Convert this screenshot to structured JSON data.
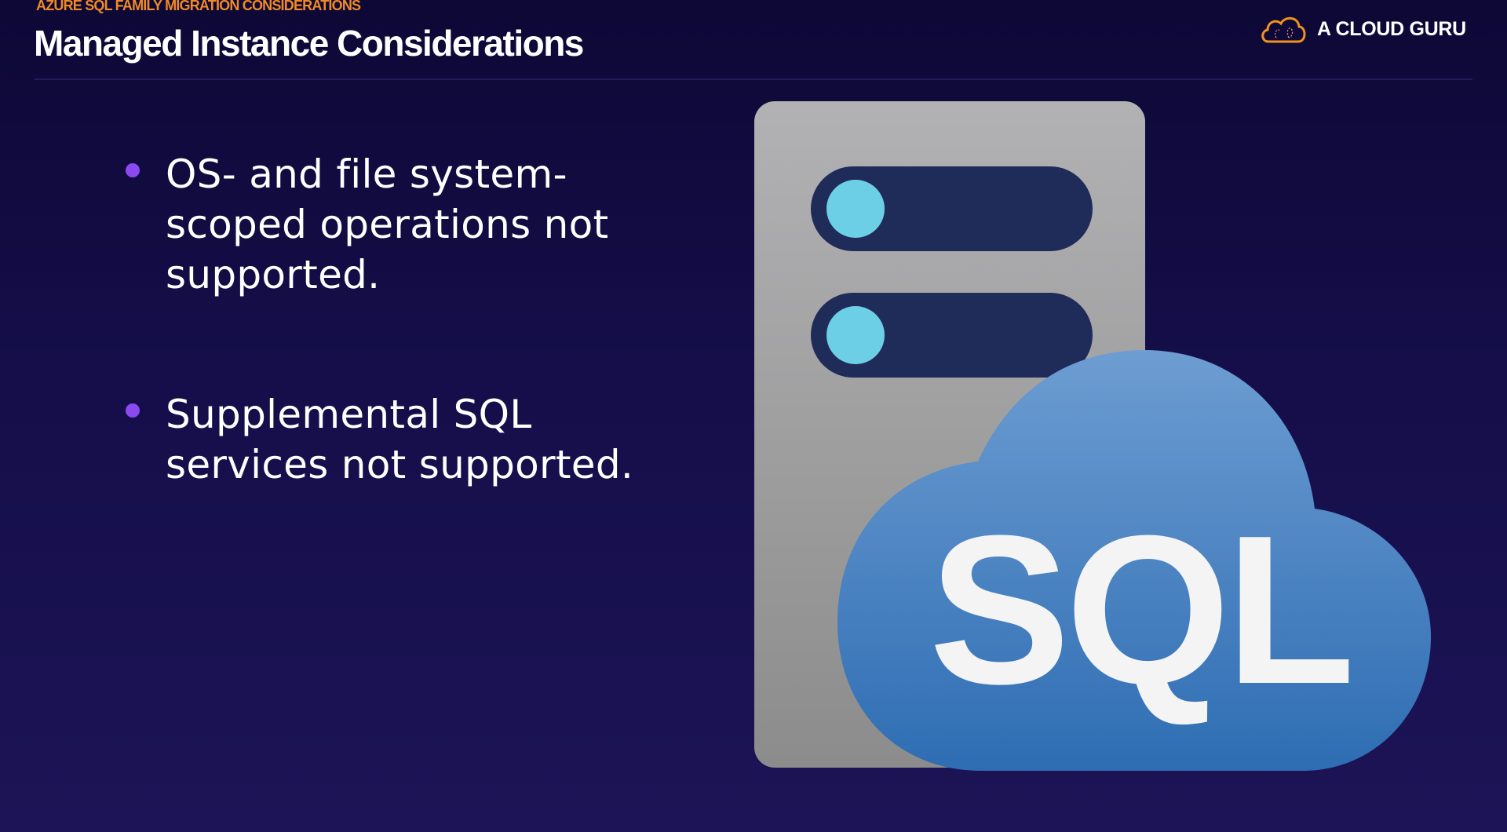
{
  "header": {
    "kicker": "AZURE SQL FAMILY MIGRATION CONSIDERATIONS",
    "title": "Managed Instance Considerations"
  },
  "logo": {
    "text": "A CLOUD GURU",
    "icon": "cloud-logo-icon",
    "color": "#f0921e"
  },
  "bullets": [
    {
      "text": "OS- and file system-scoped operations not supported."
    },
    {
      "text": "Supplemental SQL services not supported."
    }
  ],
  "illustration": {
    "label": "SQL",
    "icon": "server-sql-cloud-icon",
    "accent": "#6dcfe6"
  }
}
